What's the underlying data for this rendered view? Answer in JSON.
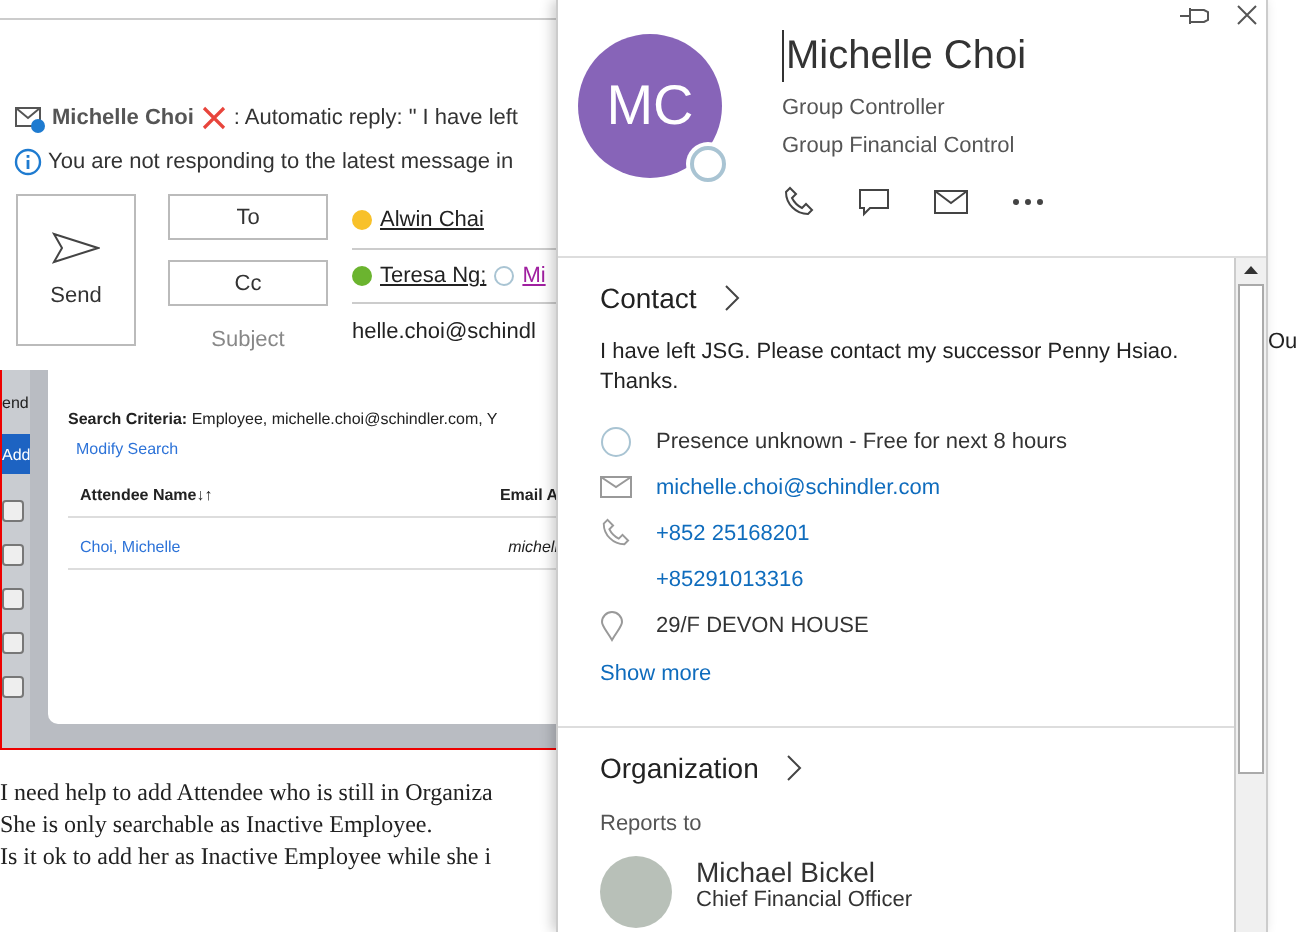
{
  "compose": {
    "autoreply_banner": {
      "sender": "Michelle Choi",
      "text": ": Automatic reply: \"  I have left"
    },
    "info_banner": "You are not responding to the latest message in",
    "send_button": "Send",
    "to_button": "To",
    "cc_button": "Cc",
    "subject_label": "Subject",
    "to_recipients": [
      {
        "name": "Alwin Chai",
        "color": "#f8c12a",
        "kind": "resolved"
      }
    ],
    "cc_recipients": [
      {
        "name": "Teresa Ng;",
        "color": "#6bb42f",
        "kind": "resolved"
      },
      {
        "name": "Mi",
        "color": "#ffffff",
        "kind": "link"
      }
    ],
    "subject_value": "helle.choi@schindl"
  },
  "embedded_screenshot": {
    "side_label": "end",
    "add_button": "Add",
    "checkboxes": [
      {
        "checked": false
      },
      {
        "checked": false
      },
      {
        "checked": false
      },
      {
        "checked": false
      },
      {
        "checked": false
      }
    ],
    "search_criteria": "**Search Criteria:** Employee, michelle.choi@schindler.com, Y",
    "modify_search": "Modify Search",
    "columns": [
      "Attendee Name↓↑",
      "Email A"
    ],
    "rows": [
      [
        "Choi, Michelle",
        "michell"
      ]
    ]
  },
  "body_lines": [
    "I need help to add Attendee who is still in Organiza",
    "She is only searchable as Inactive Employee.",
    "Is it ok to add her as Inactive Employee while she i"
  ],
  "background_fragment": "Ou",
  "contact_card": {
    "initials": "MC",
    "name": "Michelle Choi",
    "title": "Group Controller",
    "department": "Group Financial Control",
    "contact_heading": "Contact",
    "note": "I have left JSG. Please contact my successor Penny Hsiao. Thanks.",
    "details": [
      {
        "kind": "presence",
        "text": "Presence unknown - Free for next 8 hours"
      },
      {
        "kind": "email",
        "text": "michelle.choi@schindler.com"
      },
      {
        "kind": "phone",
        "text": "+852 25168201"
      },
      {
        "kind": "phone_more",
        "text": "+85291013316"
      },
      {
        "kind": "location",
        "text": "29/F DEVON HOUSE"
      }
    ],
    "show_more": "Show more",
    "organization_heading": "Organization",
    "reports_to_label": "Reports to",
    "manager": {
      "name": "Michael Bickel",
      "title": "Chief Financial Officer"
    }
  }
}
